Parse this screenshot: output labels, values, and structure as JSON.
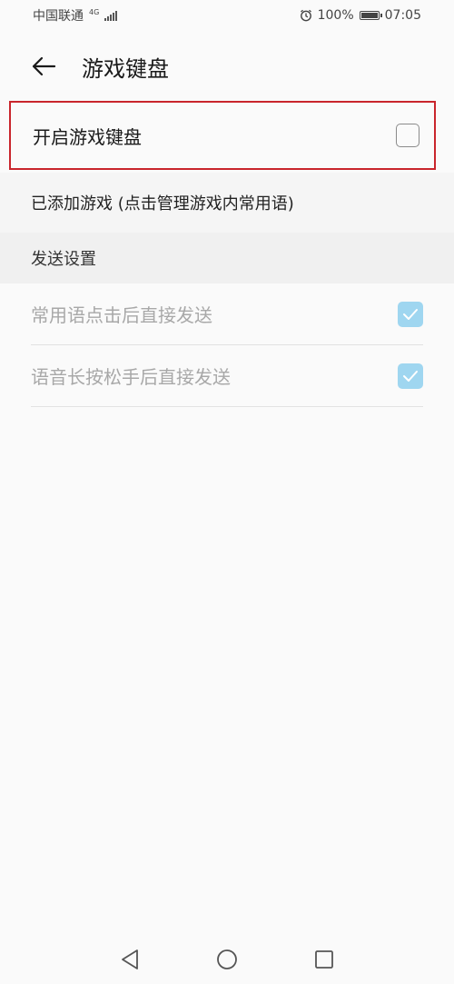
{
  "status_bar": {
    "carrier": "中国联通",
    "network": "4G",
    "battery": "100%",
    "battery_level": 1.0,
    "time": "07:05"
  },
  "header": {
    "title": "游戏键盘"
  },
  "toggle": {
    "label": "开启游戏键盘",
    "checked": false
  },
  "added_games": {
    "label": "已添加游戏 (点击管理游戏内常用语)"
  },
  "send_settings": {
    "header": "发送设置",
    "items": [
      {
        "label": "常用语点击后直接发送",
        "checked": true
      },
      {
        "label": "语音长按松手后直接发送",
        "checked": true
      }
    ]
  },
  "colors": {
    "highlight_border": "#c9252c",
    "checkbox_checked": "#9fd6f0",
    "disabled_text": "#a8a8a8"
  }
}
